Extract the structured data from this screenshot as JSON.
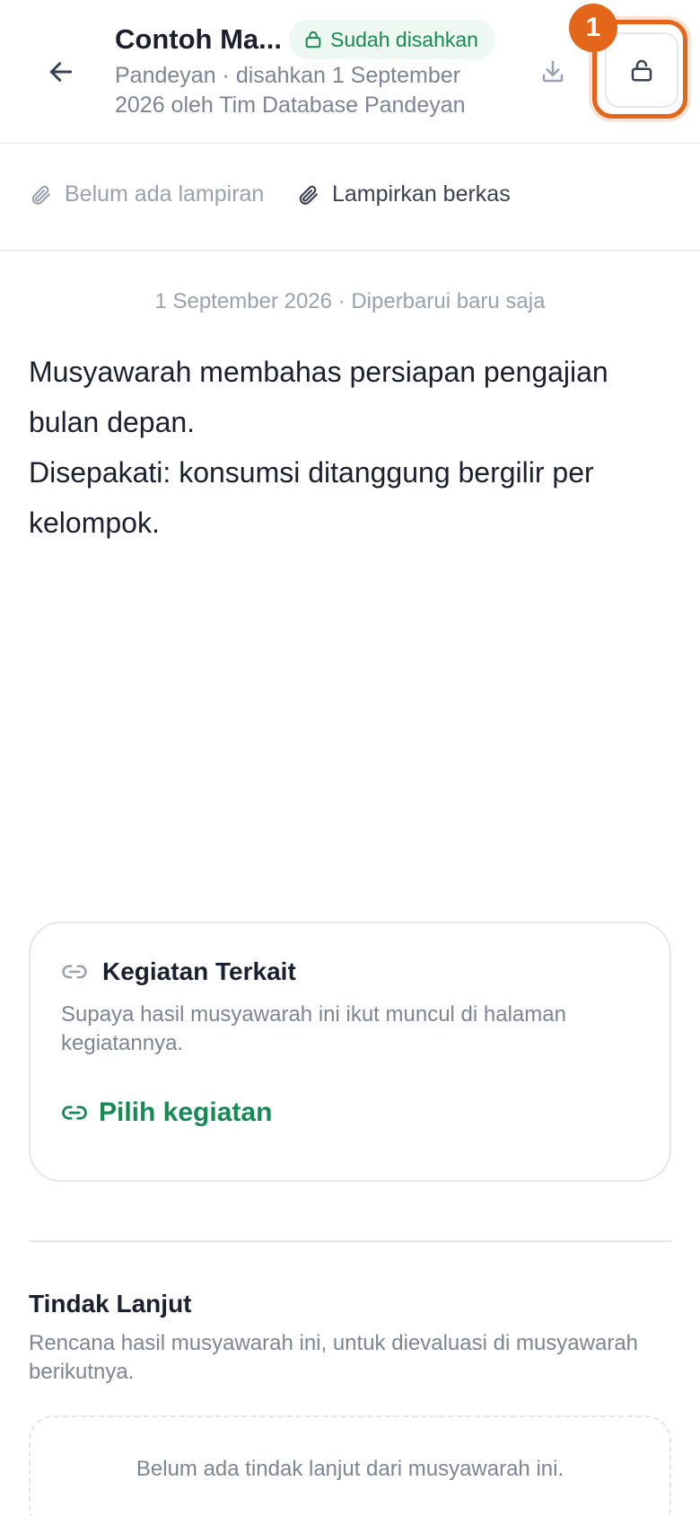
{
  "header": {
    "title": "Contoh Ma...",
    "status_badge": "Sudah disahkan",
    "subtitle": "Pandeyan · disahkan 1 September 2026 oleh Tim Database Pandeyan",
    "step_number": "1"
  },
  "attachments": {
    "empty_label": "Belum ada lampiran",
    "add_label": "Lampirkan berkas"
  },
  "meta": {
    "date_line": "1 September 2026 · Diperbarui baru saja"
  },
  "content": {
    "paragraphs": [
      "Musyawarah membahas persiapan pengajian bulan depan.",
      "Disepakati: konsumsi ditanggung bergilir per kelompok."
    ]
  },
  "related": {
    "title": "Kegiatan Terkait",
    "description": "Supaya hasil musyawarah ini ikut muncul di halaman kegiatannya.",
    "action_label": "Pilih kegiatan"
  },
  "follow_up": {
    "title": "Tindak Lanjut",
    "description": "Rencana hasil musyawarah ini, untuk dievaluasi di musyawarah berikutnya.",
    "empty_label": "Belum ada tindak lanjut dari musyawarah ini."
  },
  "colors": {
    "accent_green": "#168a55",
    "highlight_orange": "#e4661b"
  },
  "icons": [
    "arrow-left-icon",
    "lock-icon",
    "download-icon",
    "unlock-icon",
    "paperclip-icon",
    "link-icon"
  ]
}
